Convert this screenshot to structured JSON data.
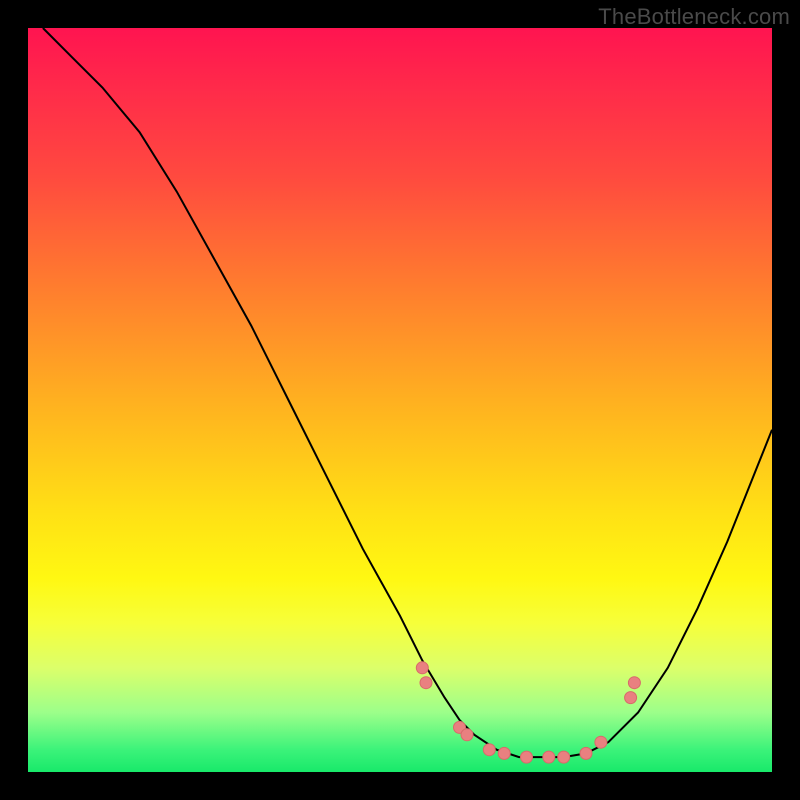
{
  "watermark": "TheBottleneck.com",
  "colors": {
    "curve_stroke": "#000000",
    "marker_fill": "#e98080",
    "marker_stroke": "#d86a6a",
    "background_black": "#000000"
  },
  "chart_data": {
    "type": "line",
    "title": "",
    "xlabel": "",
    "ylabel": "",
    "xlim": [
      0,
      100
    ],
    "ylim": [
      0,
      100
    ],
    "series": [
      {
        "name": "bottleneck-curve",
        "x": [
          2,
          6,
          10,
          15,
          20,
          25,
          30,
          35,
          40,
          45,
          50,
          53,
          56,
          58,
          60,
          63,
          66,
          69,
          72,
          75,
          78,
          82,
          86,
          90,
          94,
          98,
          100
        ],
        "y": [
          100,
          96,
          92,
          86,
          78,
          69,
          60,
          50,
          40,
          30,
          21,
          15,
          10,
          7,
          5,
          3,
          2,
          2,
          2,
          2.5,
          4,
          8,
          14,
          22,
          31,
          41,
          46
        ]
      }
    ],
    "markers": {
      "name": "highlight-dots",
      "x": [
        53,
        53.5,
        58,
        59,
        62,
        64,
        67,
        70,
        72,
        75,
        77,
        81,
        81.5
      ],
      "y": [
        14,
        12,
        6,
        5,
        3,
        2.5,
        2,
        2,
        2,
        2.5,
        4,
        10,
        12
      ]
    }
  }
}
